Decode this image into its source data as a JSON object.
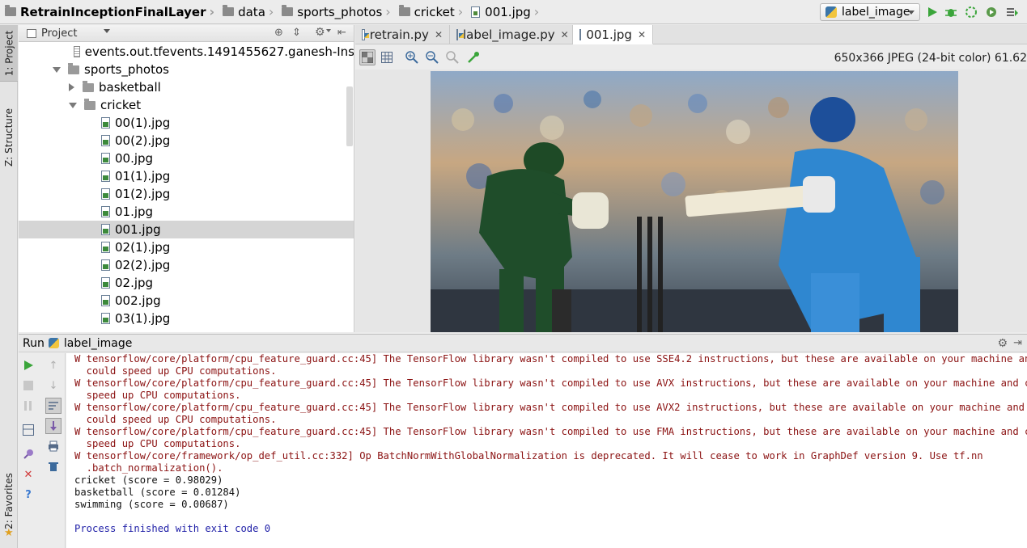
{
  "breadcrumb": {
    "items": [
      "RetrainInceptionFinalLayer",
      "data",
      "sports_photos",
      "cricket",
      "001.jpg"
    ]
  },
  "toolbar": {
    "run_config": "label_image",
    "icons": [
      "run-icon",
      "debug-icon",
      "coverage-icon",
      "profile-icon",
      "vcs-update-icon"
    ]
  },
  "side_tabs": {
    "project": "1: Project",
    "structure": "Z: Structure",
    "favorites": "2: Favorites"
  },
  "project_panel": {
    "title": "Project",
    "tree": [
      {
        "label": "events.out.tfevents.1491455627.ganesh-Ins",
        "type": "text-file",
        "indent": 3
      },
      {
        "label": "sports_photos",
        "type": "folder-open",
        "indent": 1
      },
      {
        "label": "basketball",
        "type": "folder-closed",
        "indent": 2
      },
      {
        "label": "cricket",
        "type": "folder-open",
        "indent": 2
      },
      {
        "label": "00(1).jpg",
        "type": "image",
        "indent": 3
      },
      {
        "label": "00(2).jpg",
        "type": "image",
        "indent": 3
      },
      {
        "label": "00.jpg",
        "type": "image",
        "indent": 3
      },
      {
        "label": "01(1).jpg",
        "type": "image",
        "indent": 3
      },
      {
        "label": "01(2).jpg",
        "type": "image",
        "indent": 3
      },
      {
        "label": "01.jpg",
        "type": "image",
        "indent": 3
      },
      {
        "label": "001.jpg",
        "type": "image",
        "indent": 3,
        "selected": true
      },
      {
        "label": "02(1).jpg",
        "type": "image",
        "indent": 3
      },
      {
        "label": "02(2).jpg",
        "type": "image",
        "indent": 3
      },
      {
        "label": "02.jpg",
        "type": "image",
        "indent": 3
      },
      {
        "label": "002.jpg",
        "type": "image",
        "indent": 3
      },
      {
        "label": "03(1).jpg",
        "type": "image",
        "indent": 3
      }
    ]
  },
  "editor": {
    "tabs": [
      {
        "label": "retrain.py",
        "active": false
      },
      {
        "label": "label_image.py",
        "active": false
      },
      {
        "label": "001.jpg",
        "active": true
      }
    ],
    "image_info": "650x366 JPEG (24-bit color) 61.62",
    "image_alt": "Cricket photo: wicketkeeper in green and batsman in blue at the stumps"
  },
  "run_panel": {
    "title": "Run",
    "config": "label_image",
    "console": [
      {
        "kind": "err",
        "text": "W tensorflow/core/platform/cpu_feature_guard.cc:45] The TensorFlow library wasn't compiled to use SSE4.2 instructions, but these are available on your machine and"
      },
      {
        "kind": "err",
        "text": "  could speed up CPU computations."
      },
      {
        "kind": "err",
        "text": "W tensorflow/core/platform/cpu_feature_guard.cc:45] The TensorFlow library wasn't compiled to use AVX instructions, but these are available on your machine and could"
      },
      {
        "kind": "err",
        "text": "  speed up CPU computations."
      },
      {
        "kind": "err",
        "text": "W tensorflow/core/platform/cpu_feature_guard.cc:45] The TensorFlow library wasn't compiled to use AVX2 instructions, but these are available on your machine and"
      },
      {
        "kind": "err",
        "text": "  could speed up CPU computations."
      },
      {
        "kind": "err",
        "text": "W tensorflow/core/platform/cpu_feature_guard.cc:45] The TensorFlow library wasn't compiled to use FMA instructions, but these are available on your machine and could"
      },
      {
        "kind": "err",
        "text": "  speed up CPU computations."
      },
      {
        "kind": "err",
        "text": "W tensorflow/core/framework/op_def_util.cc:332] Op BatchNormWithGlobalNormalization is deprecated. It will cease to work in GraphDef version 9. Use tf.nn"
      },
      {
        "kind": "err",
        "text": "  .batch_normalization()."
      },
      {
        "kind": "out",
        "text": "cricket (score = 0.98029)"
      },
      {
        "kind": "out",
        "text": "basketball (score = 0.01284)"
      },
      {
        "kind": "out",
        "text": "swimming (score = 0.00687)"
      },
      {
        "kind": "out",
        "text": ""
      },
      {
        "kind": "exit",
        "text": "Process finished with exit code 0"
      }
    ]
  }
}
